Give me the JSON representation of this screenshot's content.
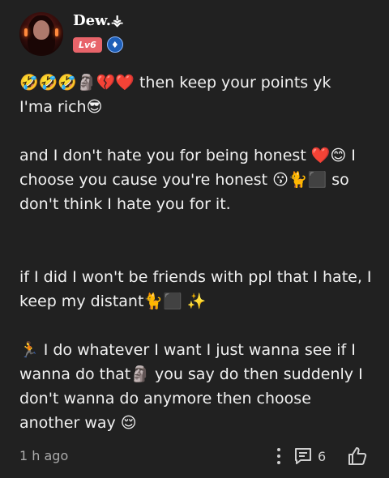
{
  "post": {
    "author": "Dew.⚶",
    "level_badge": "Lv6",
    "verified_symbol": "♦",
    "paragraphs": [
      "🤣🤣🤣🗿💔❤️ then keep your points yk",
      "I'ma rich😎",
      "and I don't hate you for being honest ❤️😊 I choose you cause you're honest 😗🐈⬛ so don't think I hate you for it.",
      "if I did I won't be friends with ppl that I hate, I keep my distant🐈⬛ ✨",
      "🏃 I do whatever I want I just wanna see if I wanna do that🗿 you say do then suddenly I don't wanna do anymore then choose another way 😌"
    ]
  },
  "footer": {
    "time": "1 h ago",
    "comment_count": "6"
  }
}
